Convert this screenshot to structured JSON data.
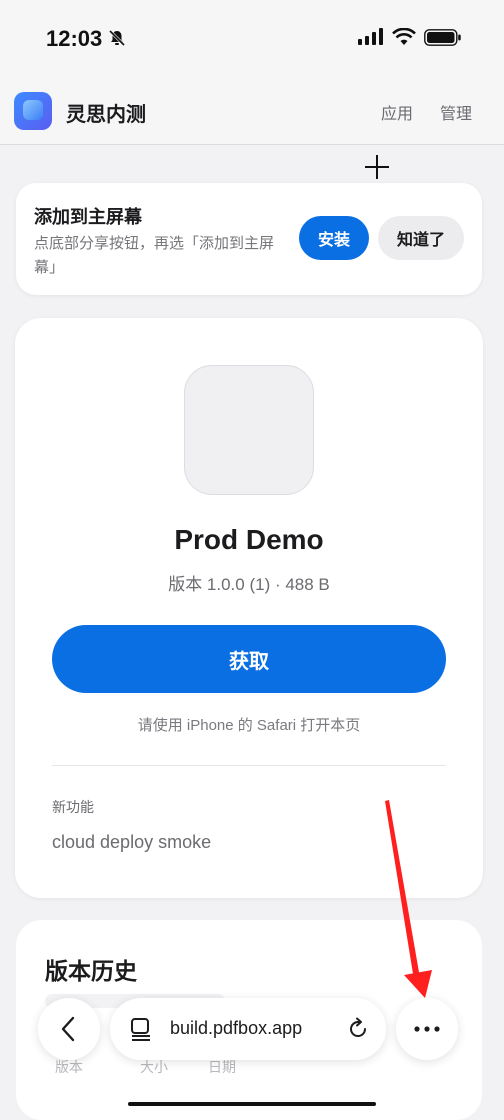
{
  "status_bar": {
    "time": "12:03"
  },
  "header": {
    "title": "灵思内测",
    "nav": {
      "apps": "应用",
      "manage": "管理"
    }
  },
  "banner": {
    "title": "添加到主屏幕",
    "description": "点底部分享按钮，再选「添加到主屏幕」",
    "install_label": "安装",
    "dismiss_label": "知道了"
  },
  "app": {
    "name": "Prod Demo",
    "version_line": "版本 1.0.0 (1) · 488 B",
    "get_label": "获取",
    "safari_hint": "请使用 iPhone 的 Safari 打开本页",
    "whats_new_label": "新功能",
    "whats_new_text": "cloud deploy smoke"
  },
  "history": {
    "title": "版本历史",
    "columns": [
      "版本",
      "大小",
      "日期"
    ]
  },
  "browser": {
    "url": "build.pdfbox.app"
  },
  "colors": {
    "accent": "#0a6fe3",
    "annotation_arrow": "#ff1f1f"
  }
}
